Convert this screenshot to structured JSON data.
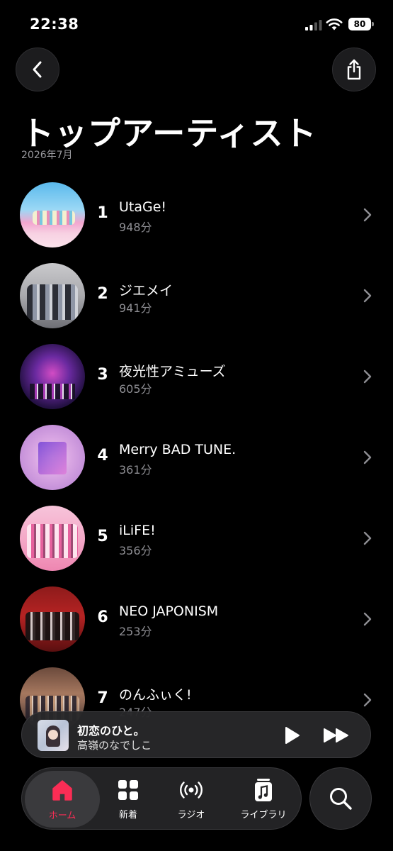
{
  "status_bar": {
    "time": "22:38",
    "battery": "80"
  },
  "header": {
    "title": "トップアーティスト",
    "subtitle": "2026年7月"
  },
  "artists": [
    {
      "rank": "1",
      "name": "UtaGe!",
      "minutes": "948分"
    },
    {
      "rank": "2",
      "name": "ジエメイ",
      "minutes": "941分"
    },
    {
      "rank": "3",
      "name": "夜光性アミューズ",
      "minutes": "605分"
    },
    {
      "rank": "4",
      "name": "Merry BAD TUNE.",
      "minutes": "361分"
    },
    {
      "rank": "5",
      "name": "iLiFE!",
      "minutes": "356分"
    },
    {
      "rank": "6",
      "name": "NEO JAPONISM",
      "minutes": "253分"
    },
    {
      "rank": "7",
      "name": "のんふぃく!",
      "minutes": "247分"
    }
  ],
  "now_playing": {
    "title": "初恋のひと。",
    "artist": "高嶺のなでしこ"
  },
  "tabs": [
    {
      "label": "ホーム",
      "icon": "home-icon",
      "selected": true
    },
    {
      "label": "新着",
      "icon": "grid-icon"
    },
    {
      "label": "ラジオ",
      "icon": "radio-icon"
    },
    {
      "label": "ライブラリ",
      "icon": "library-icon"
    }
  ],
  "colors": {
    "accent": "#fa2d55",
    "background": "#000000",
    "secondary_text": "#8e8e93"
  }
}
